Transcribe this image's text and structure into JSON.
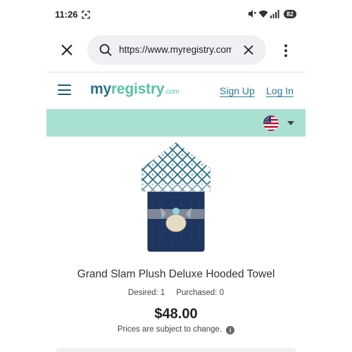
{
  "status_bar": {
    "time": "11:26",
    "battery": "82",
    "icons": [
      "screen-capture-icon",
      "mute-icon",
      "wifi-icon",
      "signal-icon"
    ]
  },
  "browser": {
    "url": "https://www.myregistry.com/",
    "icons": [
      "close-icon",
      "search-icon",
      "clear-icon",
      "more-vert-icon"
    ]
  },
  "site_header": {
    "logo": {
      "my": "my",
      "registry": "registry",
      "com": ".com"
    },
    "signup_label": "Sign Up",
    "login_label": "Log In",
    "colors": {
      "brand_dark": "#2a6f8a",
      "brand_mint": "#56c2a3",
      "mint_bar": "#a8e1d2"
    }
  },
  "region": {
    "icons": [
      "us-flag-icon",
      "caret-down-icon"
    ]
  },
  "product": {
    "title": "Grand Slam Plush Deluxe Hooded Towel",
    "desired": "Desired: 1",
    "purchased": "Purchased: 0",
    "price": "$48.00",
    "price_note": "Prices are subject to change."
  }
}
